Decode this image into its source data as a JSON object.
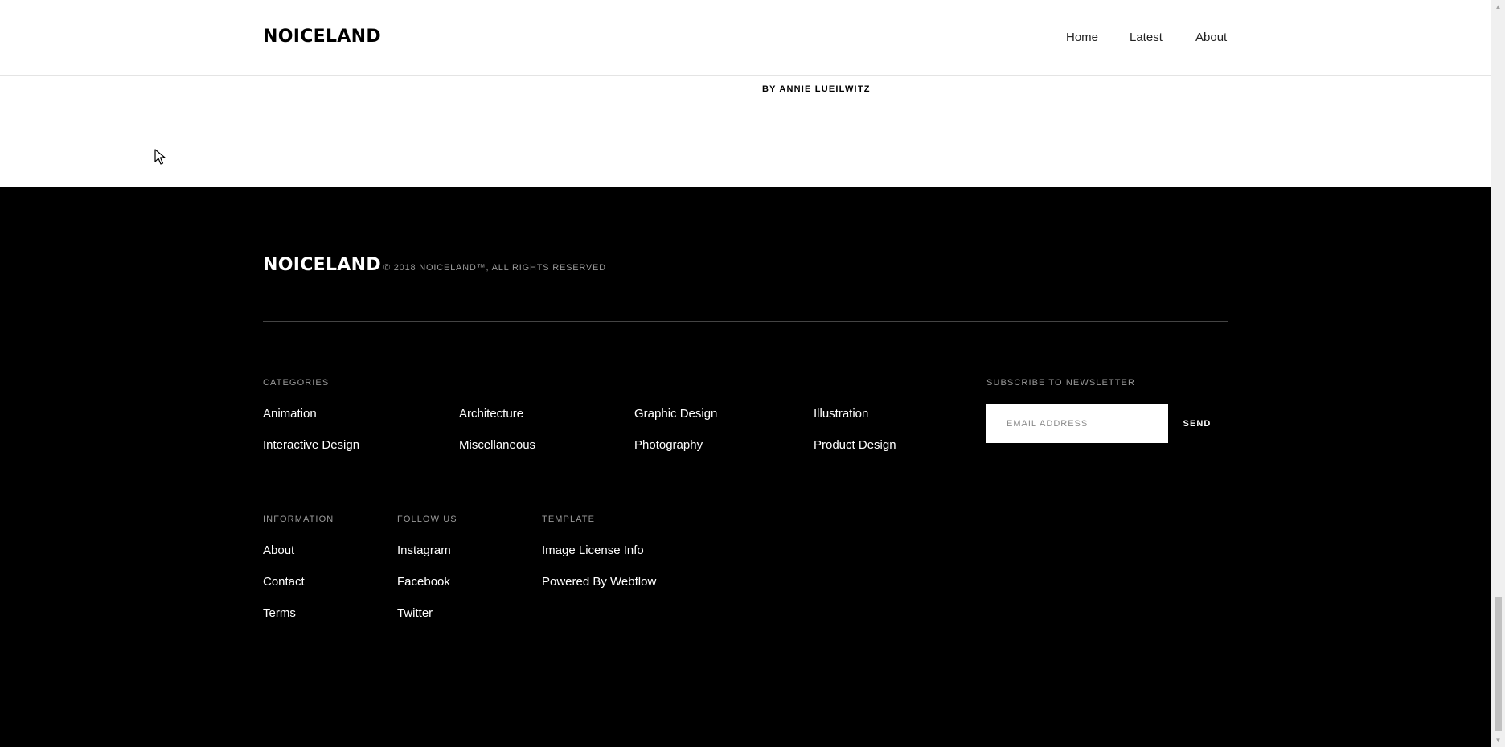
{
  "header": {
    "logo": "NOICELAND",
    "nav": {
      "home": "Home",
      "latest": "Latest",
      "about": "About"
    }
  },
  "article": {
    "byline": "BY ANNIE LUEILWITZ"
  },
  "footer": {
    "logo": "NOICELAND",
    "copyright": "© 2018 NOICELAND™, ALL RIGHTS RESERVED",
    "categories": {
      "title": "CATEGORIES",
      "items": [
        "Animation",
        "Architecture",
        "Graphic Design",
        "Illustration",
        "Interactive Design",
        "Miscellaneous",
        "Photography",
        "Product Design"
      ]
    },
    "newsletter": {
      "title": "SUBSCRIBE TO NEWSLETTER",
      "placeholder": "EMAIL ADDRESS",
      "button": "SEND"
    },
    "information": {
      "title": "INFORMATION",
      "items": [
        "About",
        "Contact",
        "Terms"
      ]
    },
    "follow": {
      "title": "FOLLOW US",
      "items": [
        "Instagram",
        "Facebook",
        "Twitter"
      ]
    },
    "template": {
      "title": "TEMPLATE",
      "items": [
        "Image License Info",
        "Powered By Webflow"
      ]
    }
  },
  "colors": {
    "footer_bg": "#000000",
    "text_muted": "#9a9a9a",
    "page_bg": "#ffffff"
  }
}
